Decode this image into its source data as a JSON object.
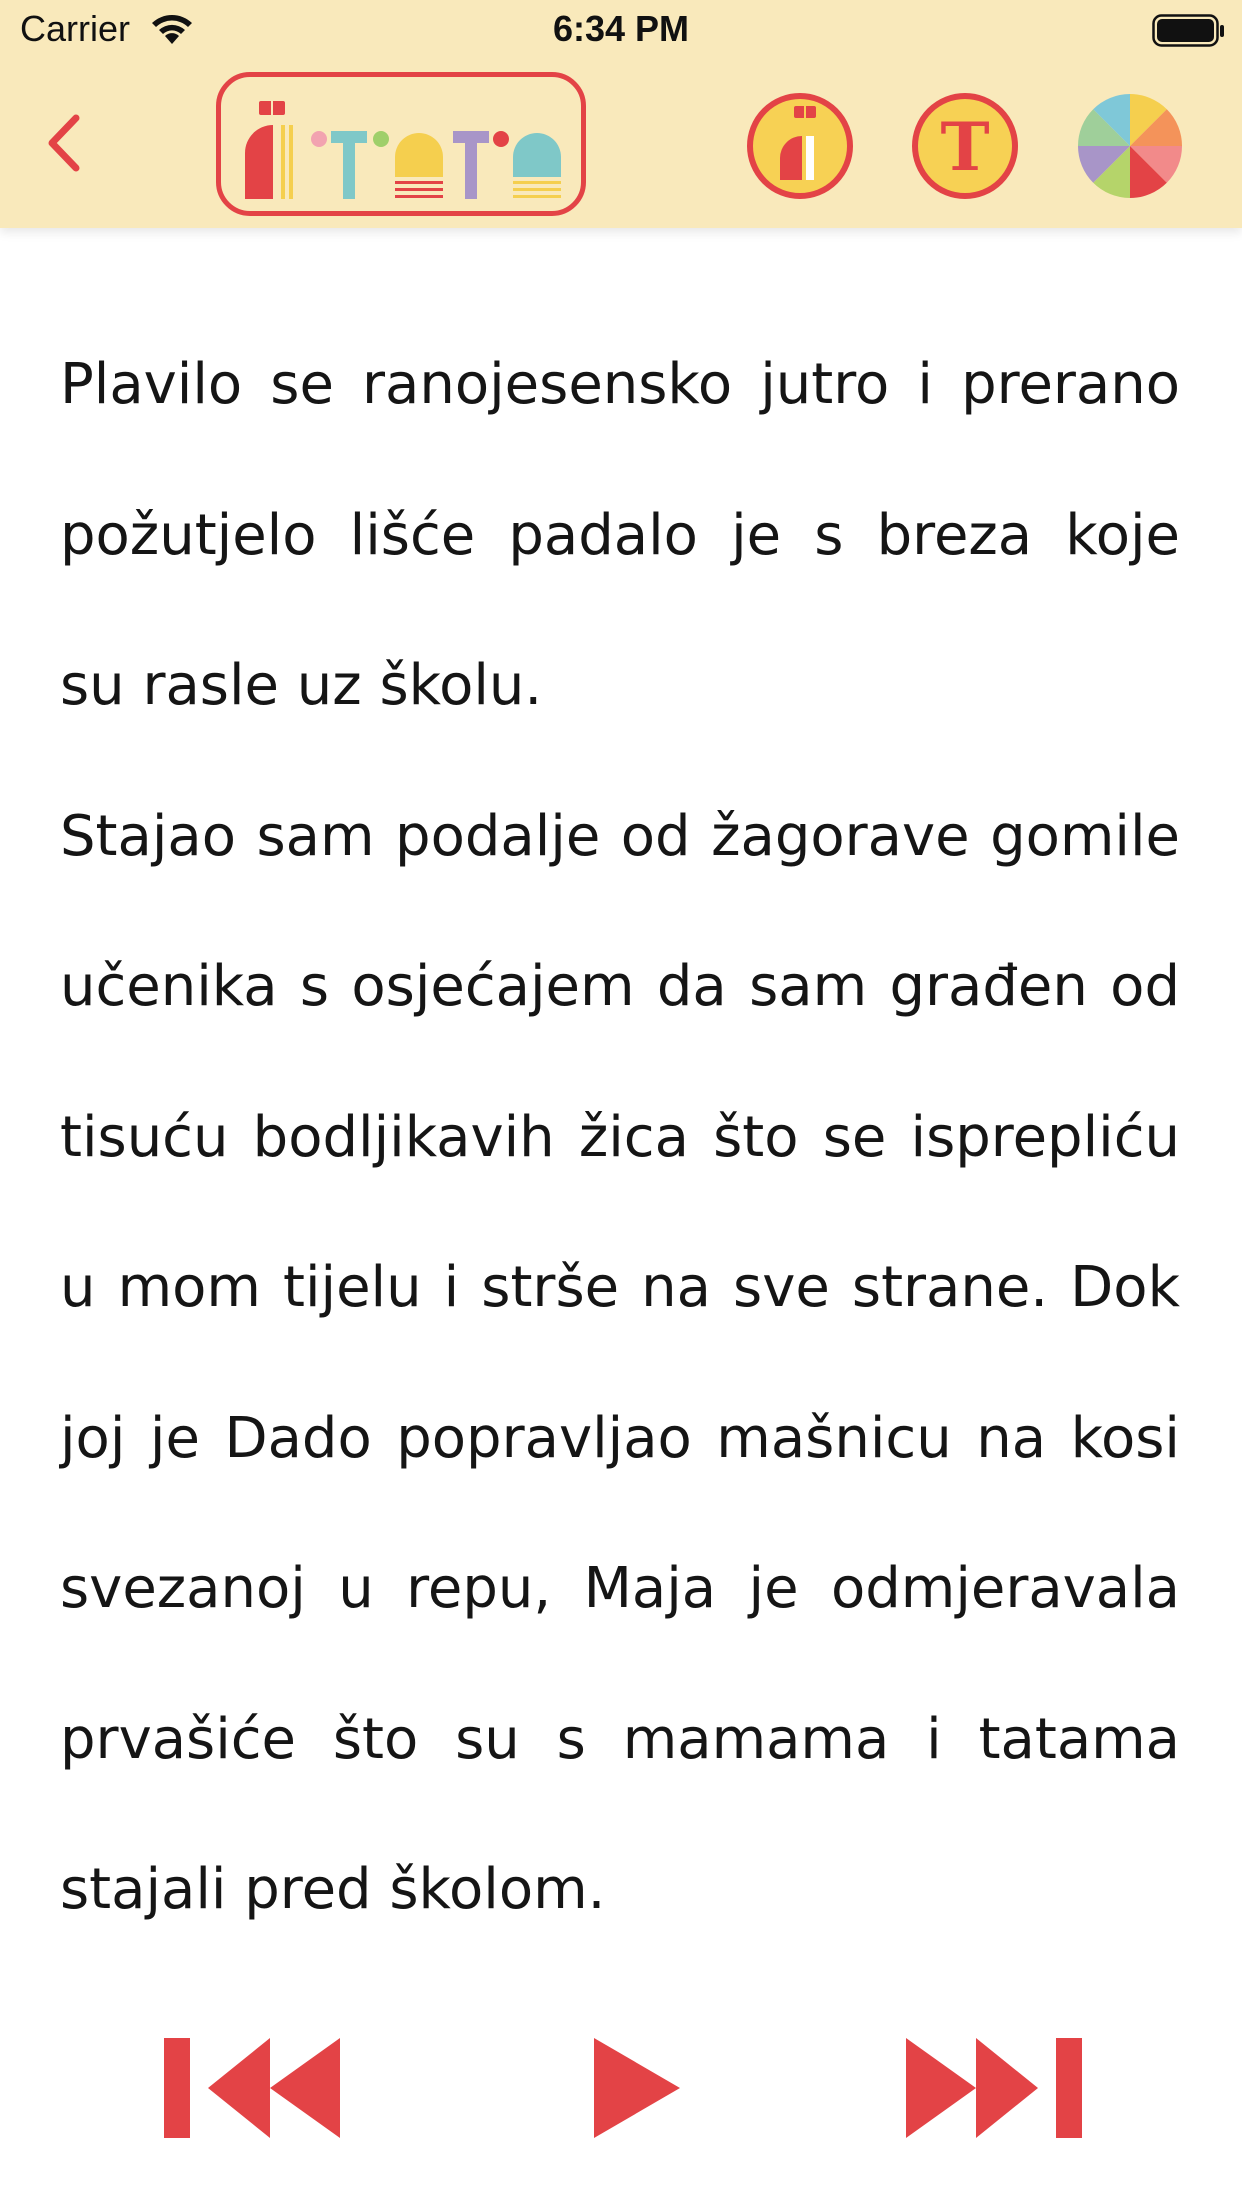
{
  "status_bar": {
    "carrier": "Carrier",
    "time": "6:34 PM"
  },
  "toolbar": {
    "back_icon": "chevron-left-icon",
    "logo_icon": "app-logo",
    "info_icon": "book-info-icon",
    "font_letter": "T",
    "color_icon": "color-wheel-icon"
  },
  "colors": {
    "accent": "#e34346",
    "header_bg": "#f9e9bb",
    "font_button_fill": "#f7d154"
  },
  "reading": {
    "lines": [
      "Plavilo se ranojesensko jutro i prerano",
      "požutjelo lišće padalo je s breza  koje",
      "su  rasle  uz  školu.",
      "Stajao sam podalje od žagorave gomile",
      "učenika s osjećajem da sam građen od",
      "tisuću bodljikavih žica što se isprepliću",
      "u mom tijelu i strše na sve strane. Dok",
      "joj je Dado popravljao mašnicu na kosi",
      "svezanoj u repu, Maja je odmjeravala",
      "prvašiće što su s mamama i tatama",
      "stajali pred školom."
    ]
  },
  "player": {
    "prev_icon": "skip-previous-icon",
    "play_icon": "play-icon",
    "next_icon": "skip-next-icon"
  }
}
